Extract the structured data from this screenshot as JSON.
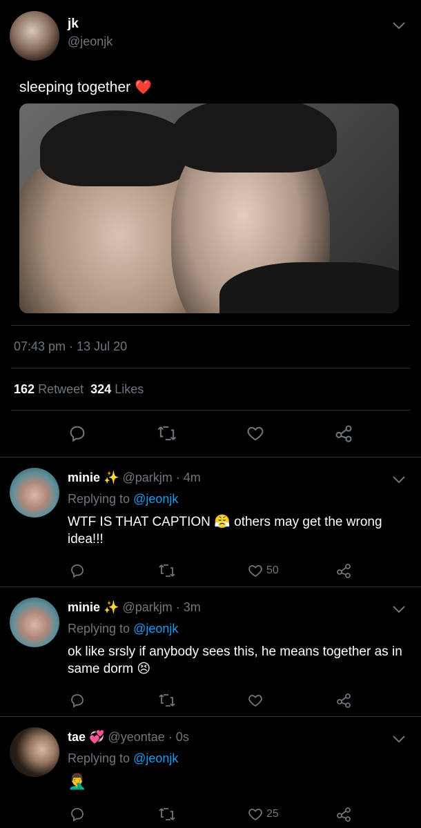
{
  "tweet": {
    "name": "jk",
    "handle": "@jeonjk",
    "text": "sleeping together",
    "emoji": "❤️",
    "time": "07:43 pm · 13 Jul 20",
    "retweet_count": "162",
    "retweet_label": "Retweet",
    "likes_count": "324",
    "likes_label": "Likes"
  },
  "replies": [
    {
      "name": "minie",
      "name_emoji": "✨",
      "handle": "@parkjm",
      "time": "· 4m",
      "replying_prefix": "Replying to",
      "replying_handle": "@jeonjk",
      "text_a": "WTF IS THAT CAPTION",
      "emoji": "😤",
      "text_b": "others may get the wrong",
      "text_c": "idea!!!",
      "likes": "50"
    },
    {
      "name": "minie",
      "name_emoji": "✨",
      "handle": "@parkjm",
      "time": "· 3m",
      "replying_prefix": "Replying to",
      "replying_handle": "@jeonjk",
      "text_a": "ok like srsly if anybody sees this, he means together as",
      "text_b": "in same dorm",
      "emoji": "😣",
      "likes": ""
    },
    {
      "name": "tae",
      "name_emoji": "💞",
      "handle": "@yeontae",
      "time": "· 0s",
      "replying_prefix": "Replying to",
      "replying_handle": "@jeonjk",
      "emoji": "🤦‍♂️",
      "likes": "25"
    }
  ],
  "colors": {
    "background": "#000000",
    "text": "#ffffff",
    "secondary": "#6e767d",
    "link": "#1d9bf0",
    "divider": "#2f3336",
    "heart": "#e0245e"
  },
  "icons": [
    "chevron-down-icon",
    "reply-icon",
    "retweet-icon",
    "heart-icon",
    "share-icon"
  ]
}
